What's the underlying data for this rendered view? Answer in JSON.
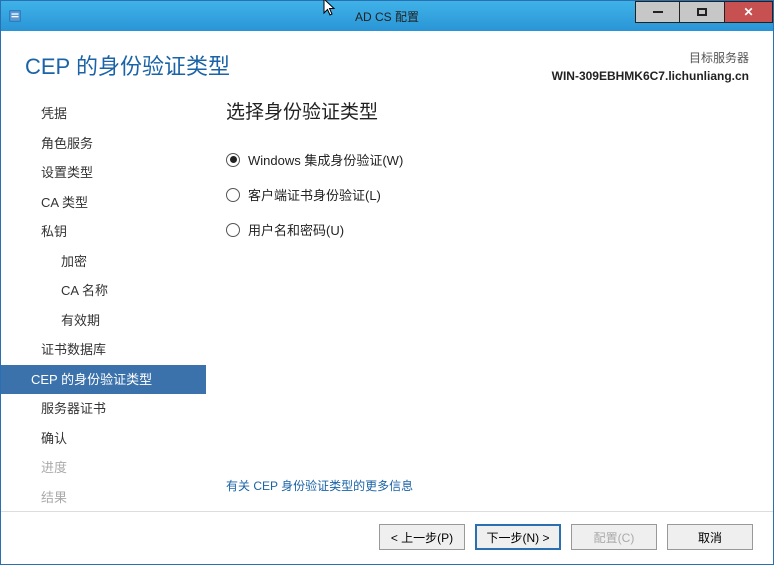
{
  "window": {
    "title": "AD CS 配置"
  },
  "header": {
    "page_title": "CEP 的身份验证类型",
    "target_label": "目标服务器",
    "target_value": "WIN-309EBHMK6C7.lichunliang.cn"
  },
  "sidebar": {
    "items": [
      {
        "label": "凭据",
        "sub": false
      },
      {
        "label": "角色服务",
        "sub": false
      },
      {
        "label": "设置类型",
        "sub": false
      },
      {
        "label": "CA 类型",
        "sub": false
      },
      {
        "label": "私钥",
        "sub": false
      },
      {
        "label": "加密",
        "sub": true
      },
      {
        "label": "CA 名称",
        "sub": true
      },
      {
        "label": "有效期",
        "sub": true
      },
      {
        "label": "证书数据库",
        "sub": false
      },
      {
        "label": "CEP 的身份验证类型",
        "sub": false,
        "selected": true
      },
      {
        "label": "服务器证书",
        "sub": false
      },
      {
        "label": "确认",
        "sub": false
      },
      {
        "label": "进度",
        "sub": false,
        "disabled": true
      },
      {
        "label": "结果",
        "sub": false,
        "disabled": true
      }
    ]
  },
  "content": {
    "heading": "选择身份验证类型",
    "options": [
      {
        "label": "Windows 集成身份验证(W)",
        "checked": true
      },
      {
        "label": "客户端证书身份验证(L)",
        "checked": false
      },
      {
        "label": "用户名和密码(U)",
        "checked": false
      }
    ],
    "more_info_link": "有关 CEP 身份验证类型的更多信息"
  },
  "footer": {
    "prev": "< 上一步(P)",
    "next": "下一步(N) >",
    "configure": "配置(C)",
    "cancel": "取消"
  }
}
